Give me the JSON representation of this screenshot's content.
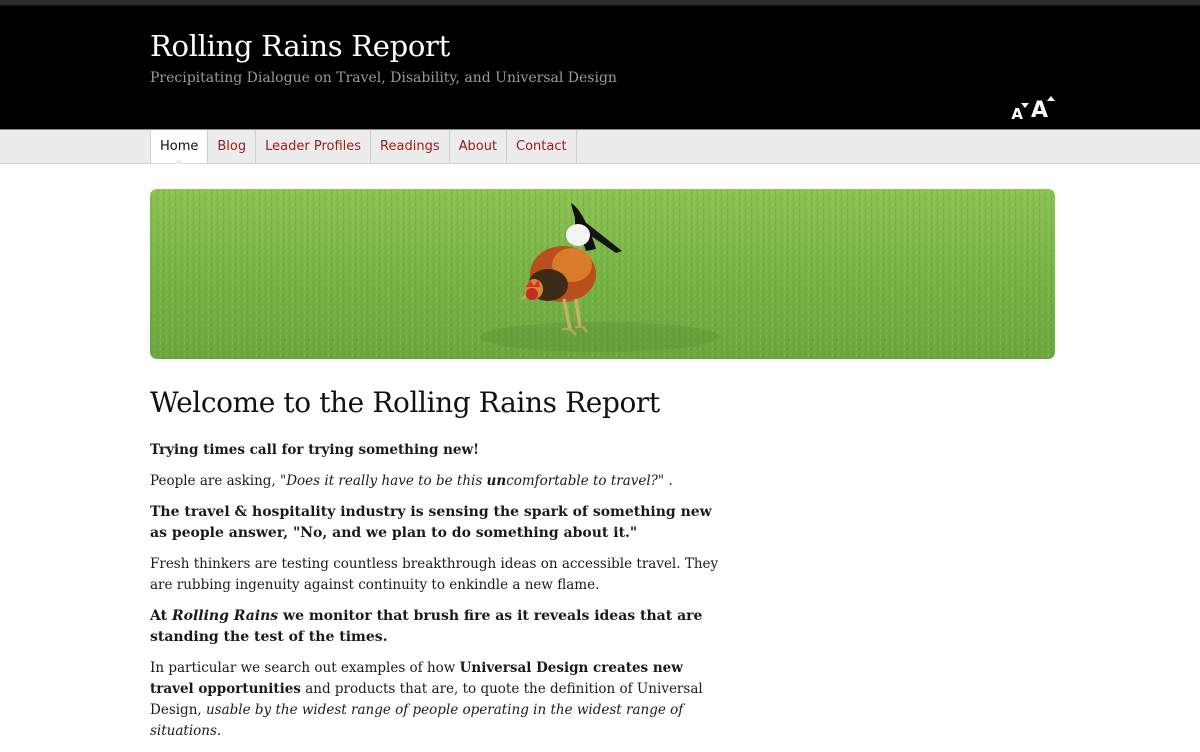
{
  "header": {
    "site_title": "Rolling Rains Report",
    "tagline": "Precipitating Dialogue on Travel, Disability, and Universal Design",
    "text_size": {
      "decrease_label": "A",
      "increase_label": "A"
    }
  },
  "nav": {
    "items": [
      {
        "label": "Home",
        "active": true
      },
      {
        "label": "Blog"
      },
      {
        "label": "Leader Profiles"
      },
      {
        "label": "Readings"
      },
      {
        "label": "About"
      },
      {
        "label": "Contact"
      }
    ]
  },
  "banner": {
    "alt": "rooster-on-grass"
  },
  "main": {
    "heading": "Welcome to the Rolling Rains Report",
    "p1": "Trying times call for trying something new!",
    "p2": {
      "a": "People are asking, \"",
      "b": "Does it really have to be this ",
      "c": "un",
      "d": "comfortable to travel?",
      "e": "\" ."
    },
    "p3": "The travel & hospitality industry is sensing the spark of something new as people answer, \"No, and we plan to do something about it.\"",
    "p4": "Fresh thinkers are testing countless breakthrough ideas on accessible travel. They are rubbing ingenuity against continuity to enkindle a new flame.",
    "p5": {
      "a": "At ",
      "b": "Rolling Rains",
      "c": " we monitor that brush fire as it reveals ideas that are standing the test of the times."
    },
    "p6": {
      "a": "In particular we search out examples of how ",
      "b": "Universal Design creates new travel opportunities",
      "c": " and products that are, to quote the definition of Universal Design, ",
      "d": "usable by the widest range of people operating in the widest range of situations",
      "e": "."
    }
  },
  "colors": {
    "link": "#9b1b12",
    "header_bg": "#000000",
    "nav_bg": "#ececec",
    "grass": "#7fb94a"
  }
}
